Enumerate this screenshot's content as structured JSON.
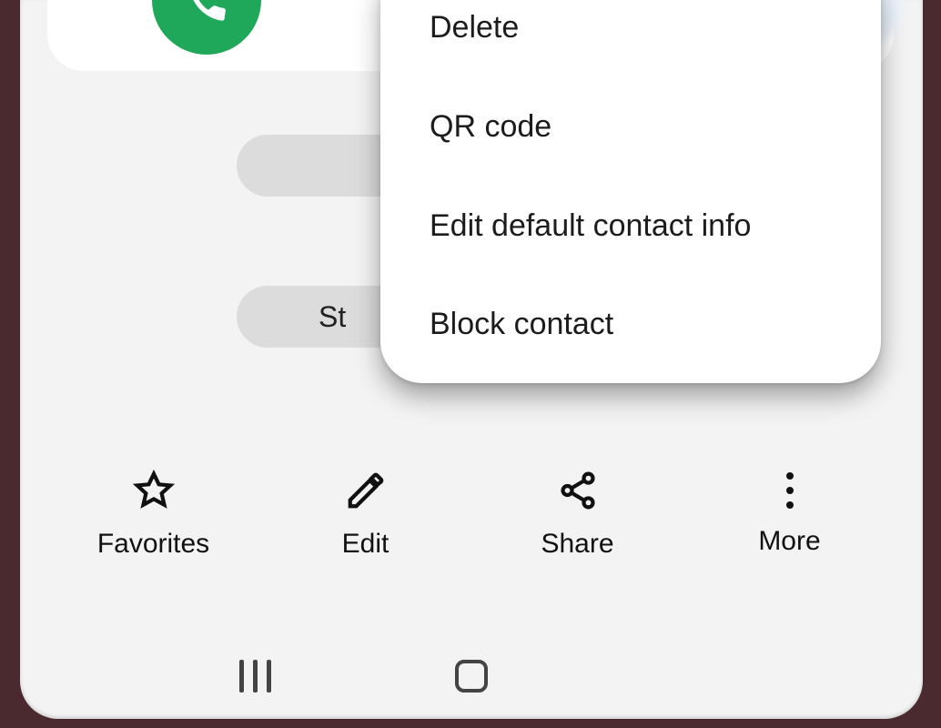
{
  "menu": {
    "items": [
      {
        "label": "Delete"
      },
      {
        "label": "QR code"
      },
      {
        "label": "Edit default contact info"
      },
      {
        "label": "Block contact"
      }
    ]
  },
  "pills": {
    "pill2_visible_text": "St"
  },
  "actions": {
    "favorites": "Favorites",
    "edit": "Edit",
    "share": "Share",
    "more": "More"
  },
  "icons": {
    "call": "phone-icon",
    "star": "star-icon",
    "pencil": "pencil-icon",
    "shareNode": "share-icon",
    "moreDots": "more-vertical-icon",
    "navRecents": "recents-icon",
    "navHome": "home-icon",
    "navBack": "back-icon"
  },
  "colors": {
    "callGreen": "#1fa85a",
    "background": "#f3f3f3",
    "menuText": "#1c1c1c",
    "pillBg": "#dcdcdc"
  }
}
